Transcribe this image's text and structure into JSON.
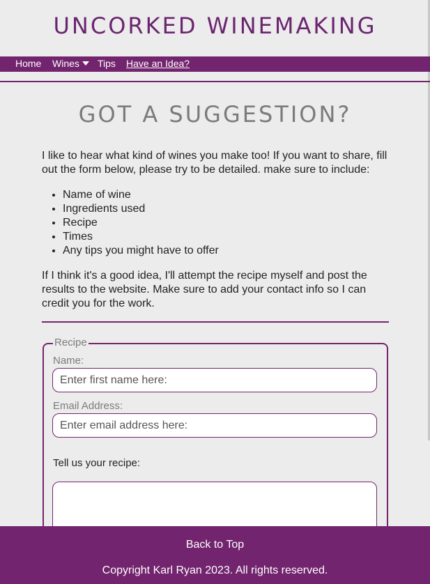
{
  "header": {
    "site_title": "UNCORKED WINEMAKING"
  },
  "nav": {
    "items": [
      {
        "label": "Home"
      },
      {
        "label": "Wines"
      },
      {
        "label": "Tips"
      },
      {
        "label": "Have an Idea?"
      }
    ]
  },
  "main": {
    "heading": "GOT A SUGGESTION?",
    "intro": "I like to hear what kind of wines you make too! If you want to share, fill out the form below, please try to be detailed. make sure to include:",
    "bullets": [
      "Name of wine",
      "Ingredients used",
      "Recipe",
      "Times",
      "Any tips you might have to offer"
    ],
    "outro": "If I think it's a good idea, I'll attempt the recipe myself and post the results to the website. Make sure to add your contact info so I can credit you for the work."
  },
  "form": {
    "legend": "Recipe",
    "name_label": "Name:",
    "name_placeholder": "Enter first name here:",
    "email_label": "Email Address:",
    "email_placeholder": "Enter email address here:",
    "recipe_label": "Tell us your recipe:"
  },
  "footer": {
    "back_to_top": "Back to Top",
    "copyright": "Copyright Karl Ryan 2023. All rights reserved."
  },
  "colors": {
    "accent": "#73246e",
    "background": "#ececec",
    "muted_text": "#7b7b7b"
  }
}
